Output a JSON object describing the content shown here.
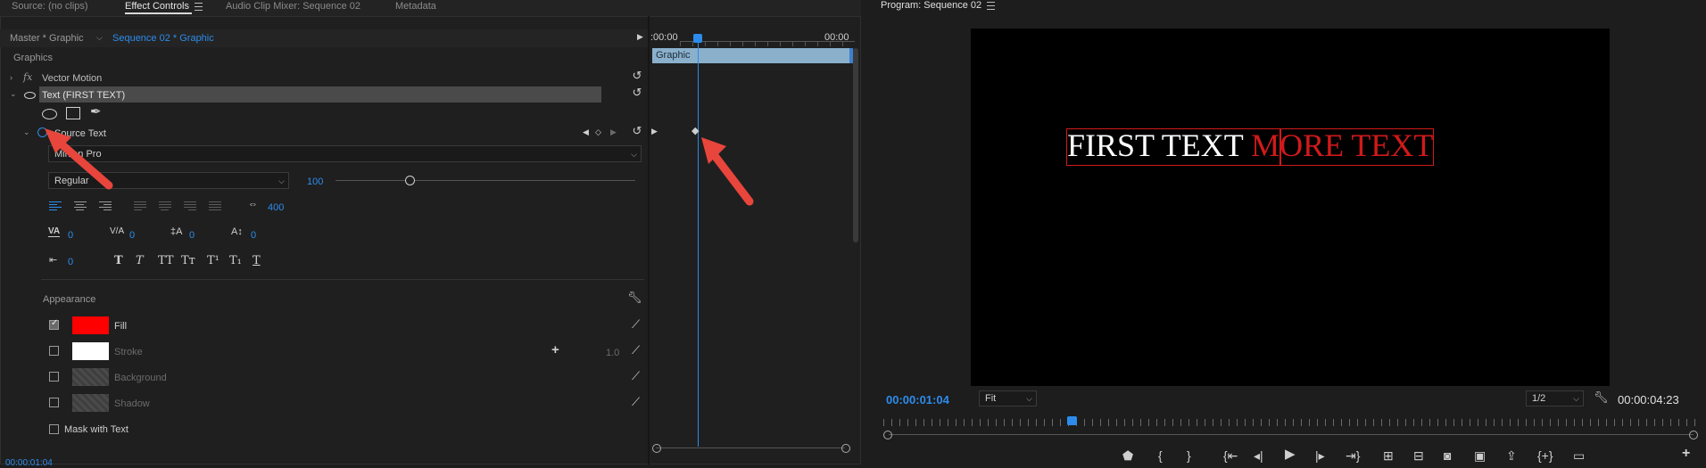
{
  "tabs": {
    "source": "Source: (no clips)",
    "effect_controls": "Effect Controls",
    "audio_mixer": "Audio Clip Mixer: Sequence 02",
    "metadata": "Metadata"
  },
  "effect_controls": {
    "master_label": "Master * Graphic",
    "sequence_label": "Sequence 02 * Graphic",
    "section_graphics": "Graphics",
    "vector_motion": "Vector Motion",
    "fx_label": "fx",
    "text_layer": "Text (FIRST TEXT)",
    "source_text": "Source Text",
    "font_name": "Minion Pro",
    "font_style": "Regular",
    "font_size": "100",
    "tracking": "400",
    "kerning": "0",
    "leading_va": "0",
    "baseline": "0",
    "tsume": "0",
    "tab_width": "0",
    "appearance": "Appearance",
    "fill_label": "Fill",
    "stroke_label": "Stroke",
    "stroke_width": "1.0",
    "background_label": "Background",
    "shadow_label": "Shadow",
    "mask_label": "Mask with Text",
    "fill_color": "#ff0000",
    "stroke_color": "#ffffff",
    "timeline_start": ":00:00",
    "timeline_end": "00:00",
    "clip_name": "Graphic",
    "bottom_tc": "00:00:01:04"
  },
  "program": {
    "title": "Program: Sequence 02",
    "text_white": "FIRST TEXT ",
    "text_red": "MORE TEXT",
    "current_tc": "00:00:01:04",
    "fit": "Fit",
    "resolution": "1/2",
    "duration_tc": "00:00:04:23"
  },
  "icons": [
    "menu-icon",
    "chevron-right-icon",
    "chevron-down-icon",
    "reset-icon",
    "eye-icon",
    "ellipse-icon",
    "rectangle-icon",
    "pen-icon",
    "stopwatch-icon",
    "keyframe-icon",
    "wrench-icon",
    "eyedropper-icon",
    "plus-icon",
    "play-icon"
  ]
}
